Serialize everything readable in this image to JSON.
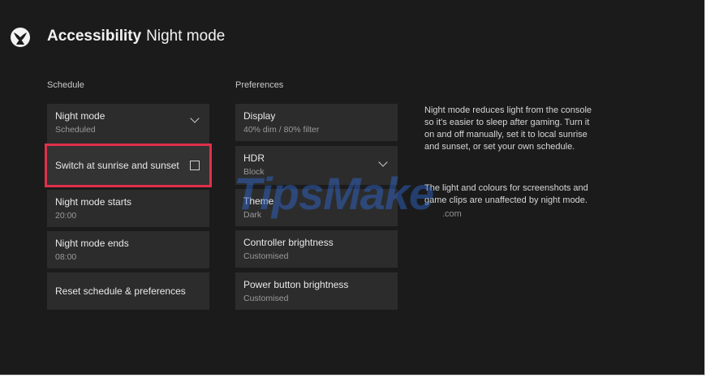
{
  "header": {
    "title_bold": "Accessibility",
    "title_rest": "Night mode",
    "logo_icon": "xbox-logo-icon"
  },
  "schedule": {
    "heading": "Schedule",
    "night_mode": {
      "label": "Night mode",
      "value": "Scheduled"
    },
    "switch_sunrise": {
      "label": "Switch at sunrise and sunset",
      "checked": false
    },
    "starts": {
      "label": "Night mode starts",
      "value": "20:00"
    },
    "ends": {
      "label": "Night mode ends",
      "value": "08:00"
    },
    "reset": {
      "label": "Reset schedule & preferences"
    }
  },
  "preferences": {
    "heading": "Preferences",
    "display": {
      "label": "Display",
      "value": "40% dim / 80% filter"
    },
    "hdr": {
      "label": "HDR",
      "value": "Block"
    },
    "theme": {
      "label": "Theme",
      "value": "Dark"
    },
    "controller": {
      "label": "Controller brightness",
      "value": "Customised"
    },
    "power": {
      "label": "Power button brightness",
      "value": "Customised"
    }
  },
  "description": {
    "p1": "Night mode reduces light from the console so it's easier to sleep after gaming. Turn it on and off manually, set it to local sunrise and sunset, or set your own schedule.",
    "p2": "The light and colours for screenshots and game clips are unaffected by night mode."
  },
  "watermark": {
    "text": "TipsMake",
    "sub": ".com"
  },
  "colors": {
    "background": "#1b1b1b",
    "tile": "#2c2c2c",
    "focus": "#e0304a",
    "watermark": "#2f6bd6"
  }
}
